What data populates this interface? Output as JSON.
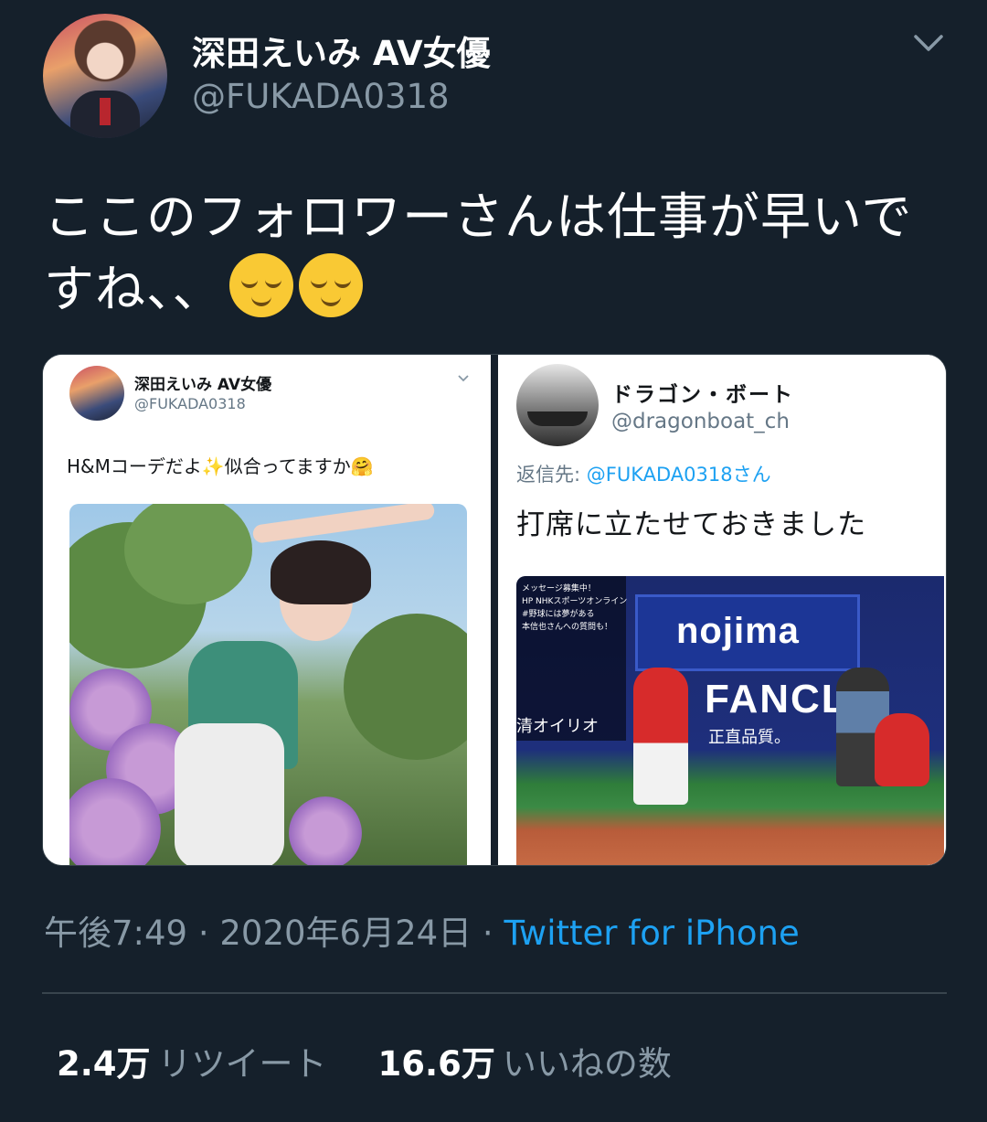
{
  "tweet": {
    "display_name": "深田えいみ AV女優",
    "handle": "@FUKADA0318",
    "text": "ここのフォロワーさんは仕事が早いですね、、",
    "emoji": [
      "relieved-face",
      "relieved-face"
    ],
    "timestamp": "午後7:49 · 2020年6月24日 · ",
    "source": "Twitter for iPhone",
    "stats": {
      "retweets_count": "2.4万",
      "retweets_label": "リツイート",
      "likes_count": "16.6万",
      "likes_label": "いいねの数"
    }
  },
  "media": {
    "left": {
      "display_name": "深田えいみ AV女優",
      "handle": "@FUKADA0318",
      "text": "H&Mコーデだよ✨似合ってますか🤗"
    },
    "right": {
      "display_name": "ドラゴン・ボート",
      "handle": "@dragonboat_ch",
      "reply_prefix": "返信先: ",
      "reply_mention": "@FUKADA0318さん",
      "text": "打席に立たせておきました",
      "photo": {
        "ad_text": "nojima",
        "fancl_text": "FANCL",
        "fancl_sub": "正直品質。",
        "overlay_lines": [
          "メッセージ募集中！",
          "HP NHKスポーツオンライン",
          "#野球には夢がある",
          "本信也さんへの質問も！"
        ],
        "side_text": "清オイリオ"
      }
    }
  }
}
